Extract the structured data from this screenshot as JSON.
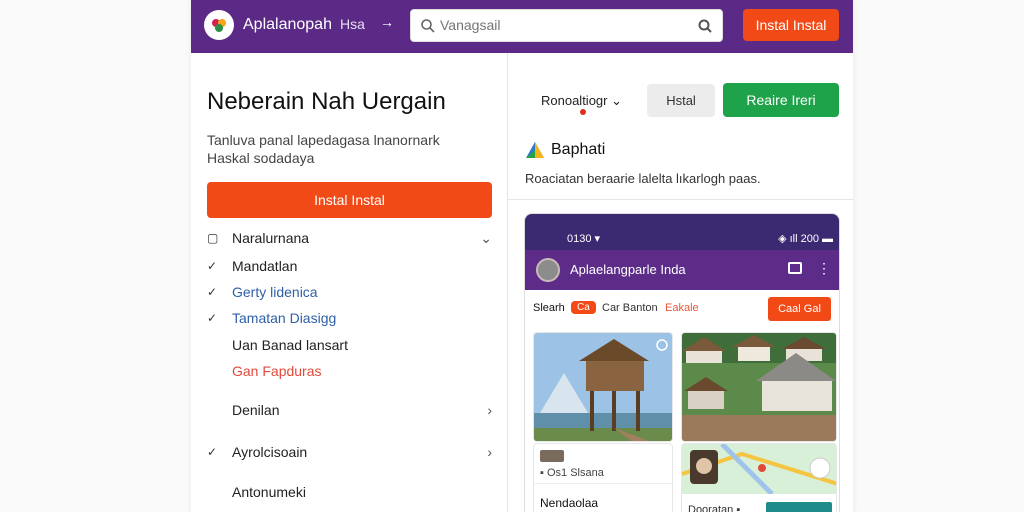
{
  "header": {
    "brand": "Aplalanopah",
    "lang": "Hsa",
    "search_placeholder": "Vanagsail",
    "install_label": "Instal Instal"
  },
  "left": {
    "title": "Neberain Nah Uergain",
    "description": "Tanluva panal lapedagasa lnanornark Haskal sodadaya",
    "install_label": "Instal Instal",
    "menu": [
      {
        "icon": "bell-icon",
        "label": "Naralurnana",
        "arrow": "chevron-down-icon",
        "color": "#222222"
      },
      {
        "icon": "check-icon",
        "label": "Mandatlan",
        "arrow": "",
        "color": "#222222"
      },
      {
        "icon": "check-icon",
        "label": "Gerty lidenica",
        "arrow": "",
        "color": "#2f5fa7"
      },
      {
        "icon": "check-icon",
        "label": "Tamatan Diasigg",
        "arrow": "",
        "color": "#2f5fa7"
      },
      {
        "icon": "",
        "label": "Uan Banad lansart",
        "arrow": "",
        "color": "#222222"
      },
      {
        "icon": "",
        "label": "Gan Fapduras",
        "arrow": "",
        "color": "#e04a3a"
      },
      {
        "icon": "",
        "label": "Denilan",
        "arrow": "chevron-right-icon",
        "color": "#222222"
      },
      {
        "icon": "check-icon",
        "label": "Ayrolcisoain",
        "arrow": "chevron-right-icon",
        "color": "#222222"
      },
      {
        "icon": "",
        "label": "Antonumeki",
        "arrow": "",
        "color": "#222222"
      }
    ]
  },
  "right": {
    "select_label": "Ronoaltiogr",
    "grey_button": "Hstal",
    "green_button": "Reaire Ireri",
    "brand_title": "Baphati",
    "description": "Roaciatan beraarie lalelta lıkarlogh paas."
  },
  "phone": {
    "time": "0130",
    "status_right": "200",
    "app_title": "Aplaelangparle Inda",
    "filter_1": "Slearh",
    "chip": "Ca",
    "filter_2": "Car Banton",
    "filter_3": "Eakale",
    "filter_button": "Caal Gal",
    "card_small": "Os1 Slsana",
    "card_name": "Nendaolaa",
    "card_map_name": "Dooratan"
  },
  "colors": {
    "header_bg": "#5b2a86",
    "accent": "#f24a17",
    "green": "#1fa34a"
  }
}
